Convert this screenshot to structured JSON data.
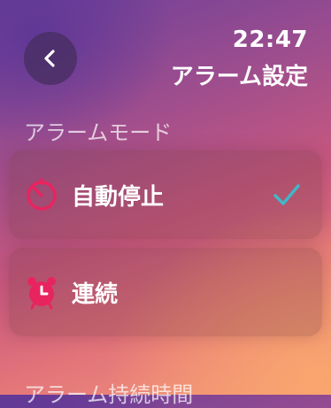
{
  "header": {
    "time": "22:47",
    "title": "アラーム設定"
  },
  "mode_section": {
    "label": "アラームモード",
    "options": [
      {
        "label": "自動停止",
        "icon": "timer-icon",
        "selected": true
      },
      {
        "label": "連続",
        "icon": "alarm-clock-icon",
        "selected": false
      }
    ]
  },
  "duration_section": {
    "label": "アラーム持続時間"
  },
  "colors": {
    "accent_check": "#3fb7c9",
    "icon_pink": "#e8245f"
  }
}
